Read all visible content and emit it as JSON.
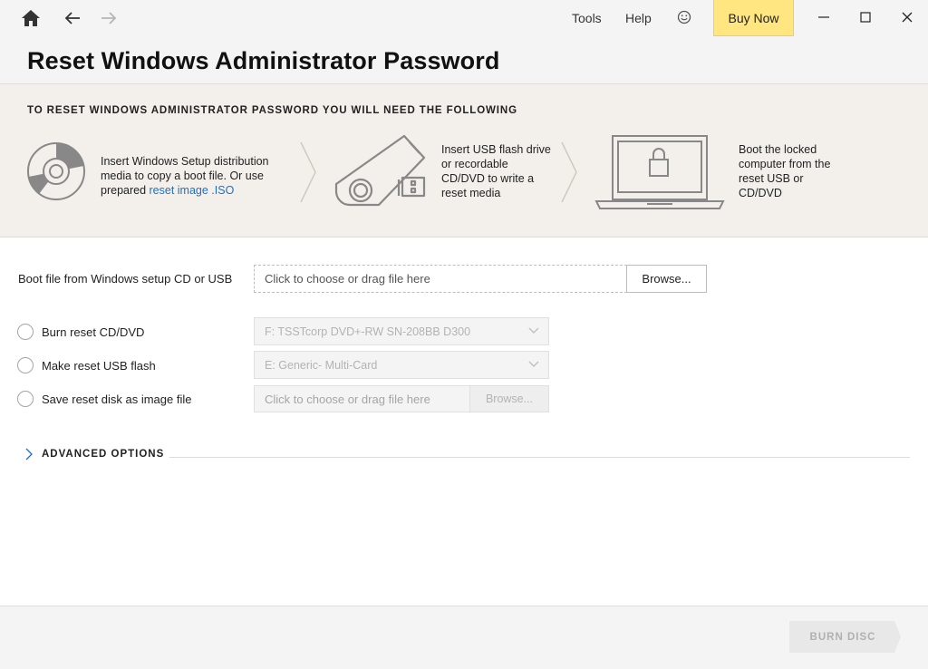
{
  "header": {
    "menu": {
      "tools": "Tools",
      "help": "Help",
      "buy_now": "Buy Now"
    },
    "title": "Reset Windows Administrator Password",
    "icons": [
      "home-icon",
      "back-arrow-icon",
      "forward-arrow-icon",
      "smiley-icon",
      "minimize-icon",
      "maximize-icon",
      "close-icon"
    ]
  },
  "steps": {
    "heading": "TO RESET WINDOWS ADMINISTRATOR PASSWORD YOU WILL NEED THE FOLLOWING",
    "step1": {
      "text": "Insert Windows Setup distribution media to copy a boot file. Or use prepared ",
      "link": "reset image .ISO",
      "icon": "disc-icon"
    },
    "step2": {
      "text": "Insert USB flash drive or recordable CD/DVD to write a reset media",
      "icon": "usb-flash-icon"
    },
    "step3": {
      "text": "Boot the locked computer from the reset USB or CD/DVD",
      "icon": "locked-laptop-icon"
    }
  },
  "form": {
    "boot_file": {
      "label": "Boot file from Windows setup CD or USB",
      "placeholder": "Click to choose or drag file here",
      "browse": "Browse..."
    },
    "options": [
      {
        "label": "Burn reset CD/DVD",
        "selected": false,
        "value": "F: TSSTcorp DVD+-RW SN-208BB D300"
      },
      {
        "label": "Make reset USB flash",
        "selected": false,
        "value": "E: Generic- Multi-Card"
      },
      {
        "label": "Save reset disk as image file",
        "selected": false,
        "placeholder": "Click to choose or drag file here",
        "browse": "Browse..."
      }
    ],
    "advanced": "ADVANCED OPTIONS"
  },
  "footer": {
    "burn": "BURN DISC"
  },
  "colors": {
    "accent_link": "#1f6fc4",
    "buy_now_bg": "#ffe680",
    "banner_bg": "#f3f0eb",
    "disabled_text": "#b0b0b0"
  }
}
